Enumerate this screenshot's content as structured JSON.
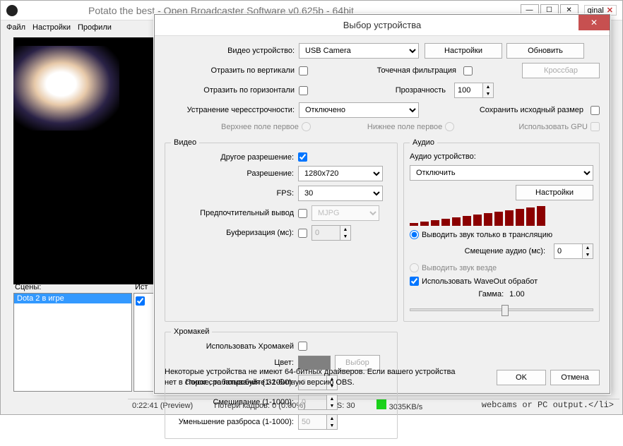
{
  "main": {
    "title": "Potato the best - Open Broadcaster Software v0.625b - 64bit",
    "extraTab": "ginal",
    "menu": [
      "Файл",
      "Настройки",
      "Профили",
      ""
    ],
    "scenesLabel": "Сцены:",
    "sourcesLabel": "Ист",
    "sceneItem": "Dota 2 в игре",
    "status": {
      "time": "0:22:41 (Preview)",
      "frames": "Потери кадров: 0 (0.00%)",
      "fps": "FPS: 30",
      "bitrate": "3035KB/s"
    },
    "bgcode2": "webcams or PC output.</li>"
  },
  "dlg": {
    "title": "Выбор устройства",
    "videoDeviceLabel": "Видео устройство:",
    "videoDevice": "USB Camera",
    "settingsBtn": "Настройки",
    "updateBtn": "Обновить",
    "flipV": "Отразить по вертикали",
    "flipH": "Отразить по горизонтали",
    "deinterlaceLabel": "Устранение чересстрочности:",
    "deinterlace": "Отключено",
    "upperFirst": "Верхнее поле первое",
    "lowerFirst": "Нижнее поле первое",
    "pointFilter": "Точечная фильтрация",
    "opacityLabel": "Прозрачность",
    "opacity": "100",
    "crossbarBtn": "Кроссбар",
    "keepSize": "Сохранить исходный размер",
    "useGPU": "Использовать GPU",
    "videoLegend": "Видео",
    "customRes": "Другое разрешение:",
    "resolutionLabel": "Разрешение:",
    "resolution": "1280x720",
    "fpsLabel": "FPS:",
    "fps": "30",
    "preferredOutput": "Предпочтительный вывод",
    "outputFormat": "MJPG",
    "bufferingLabel": "Буферизация (мс):",
    "buffering": "0",
    "audioLegend": "Аудио",
    "audioDeviceLabel": "Аудио устройство:",
    "audioDevice": "Отключить",
    "audioSettings": "Настройки",
    "broadcastOnly": "Выводить звук только в трансляцию",
    "audioOffsetLabel": "Смещение аудио (мс):",
    "audioOffset": "0",
    "everywhere": "Выводить звук везде",
    "waveOut": "Использовать WaveOut обработ",
    "gammaLabel": "Гамма:",
    "gamma": "1.00",
    "chromaLegend": "Хромакей",
    "useChroma": "Использовать Хромакей",
    "colorLabel": "Цвет:",
    "pickBtn": "Выбор",
    "thresholdLabel": "Порог срабатывания (1-1000):",
    "threshold": "0",
    "blendLabel": "Смешивание (1-1000):",
    "blend": "0",
    "spillLabel": "Уменьшение разброса (1-1000):",
    "spill": "50",
    "note": "Некоторые устройства не имеют 64-битных драйверов. Если вашего устройства нет в списке, то попробуйте 32-битную версию OBS.",
    "ok": "OK",
    "cancel": "Отмена"
  }
}
